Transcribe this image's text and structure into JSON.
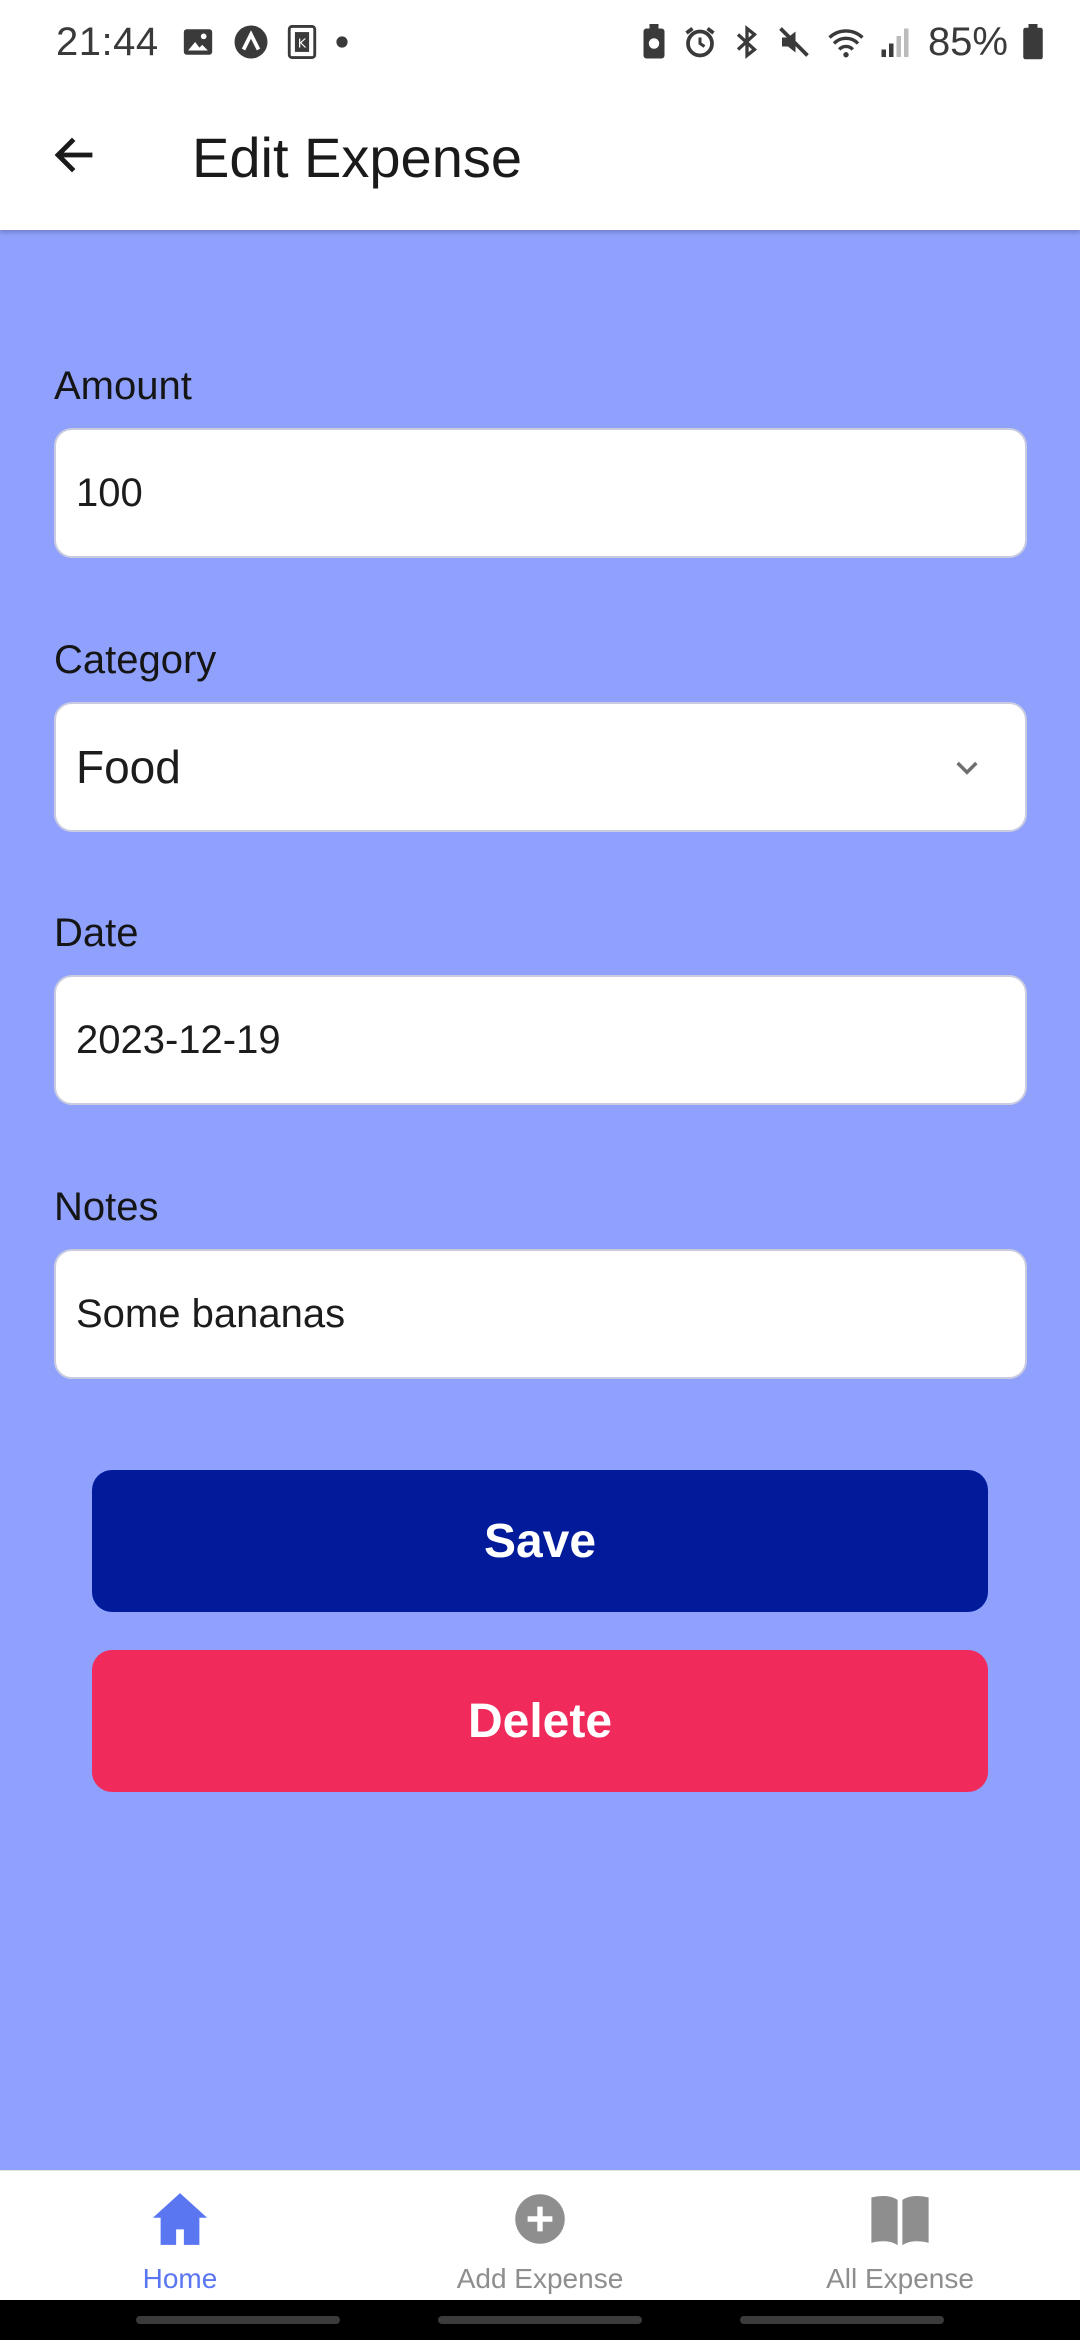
{
  "status_bar": {
    "time": "21:44",
    "battery_percent": "85%",
    "left_icons": [
      "image-icon",
      "app-circle-icon",
      "k-app-icon",
      "dot-icon"
    ],
    "right_icons": [
      "battery-saver-icon",
      "alarm-icon",
      "bluetooth-icon",
      "mute-icon",
      "wifi-icon",
      "signal-icon",
      "battery-icon"
    ]
  },
  "header": {
    "title": "Edit Expense",
    "back_icon": "arrow-left-icon"
  },
  "form": {
    "amount": {
      "label": "Amount",
      "value": "100"
    },
    "category": {
      "label": "Category",
      "value": "Food",
      "icon": "chevron-down-icon"
    },
    "date": {
      "label": "Date",
      "value": "2023-12-19"
    },
    "notes": {
      "label": "Notes",
      "value": "Some bananas"
    }
  },
  "actions": {
    "save_label": "Save",
    "delete_label": "Delete"
  },
  "bottom_nav": {
    "items": [
      {
        "label": "Home",
        "icon": "home-icon",
        "active": true
      },
      {
        "label": "Add Expense",
        "icon": "add-circle-icon",
        "active": false
      },
      {
        "label": "All Expense",
        "icon": "book-icon",
        "active": false
      }
    ]
  },
  "colors": {
    "content_background": "#8fa1fd",
    "save_button": "#011b9a",
    "delete_button": "#f02b5c",
    "active_tab": "#5a76f0",
    "inactive_tab": "#8e8e8e"
  }
}
